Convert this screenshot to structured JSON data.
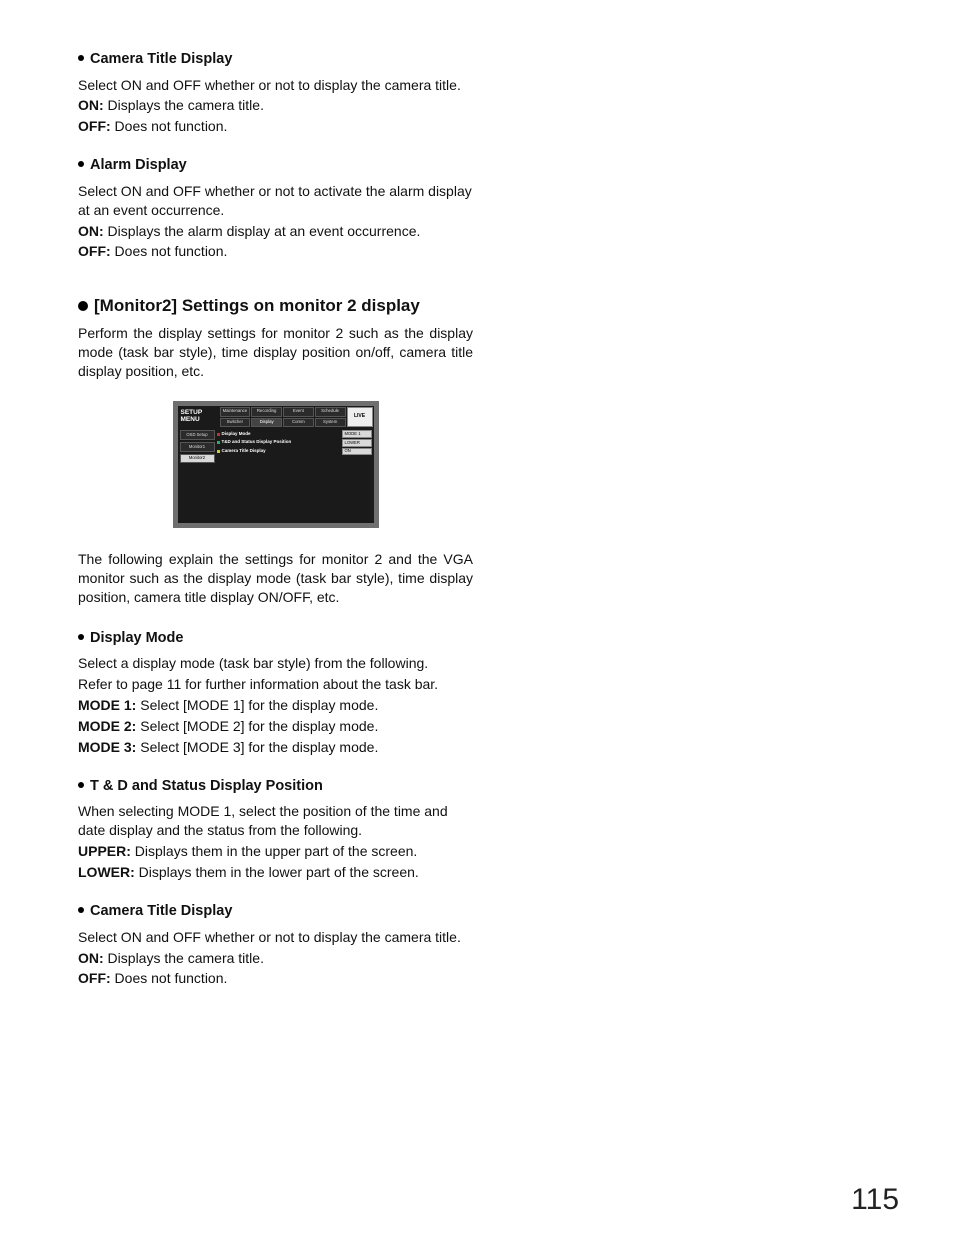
{
  "sections": {
    "camera_title_1": {
      "heading": "Camera Title Display",
      "intro": "Select ON and OFF whether or not to display the camera title.",
      "on_label": "ON:",
      "on_text": " Displays the camera title.",
      "off_label": "OFF:",
      "off_text": " Does not function."
    },
    "alarm": {
      "heading": "Alarm Display",
      "intro": "Select ON and OFF whether or not to activate the alarm display at an event occurrence.",
      "on_label": "ON:",
      "on_text": " Displays the alarm display at an event occurrence.",
      "off_label": "OFF:",
      "off_text": " Does not function."
    },
    "monitor2": {
      "heading": "[Monitor2] Settings on monitor 2 display",
      "intro": "Perform the display settings for monitor 2 such as the display mode (task bar style), time display position on/off, camera title display position, etc.",
      "after_figure": "The following explain the settings for monitor 2 and the VGA monitor such as the display mode (task bar style), time display position, camera title display ON/OFF, etc."
    },
    "display_mode": {
      "heading": "Display Mode",
      "l1": "Select a display mode (task bar style) from the following.",
      "l2": "Refer to page 11 for further information about the task bar.",
      "m1_label": "MODE 1:",
      "m1_text": " Select [MODE 1] for the display mode.",
      "m2_label": "MODE 2:",
      "m2_text": " Select [MODE 2] for the display mode.",
      "m3_label": "MODE 3:",
      "m3_text": " Select [MODE 3] for the display mode."
    },
    "td_status": {
      "heading": "T & D and Status Display Position",
      "intro": "When selecting MODE 1, select the position of the time and date display and the status from the following.",
      "upper_label": "UPPER:",
      "upper_text": " Displays them in the upper part of the screen.",
      "lower_label": "LOWER:",
      "lower_text": " Displays them in the lower part of the screen."
    },
    "camera_title_2": {
      "heading": "Camera Title Display",
      "intro": "Select ON and OFF whether or not to display the camera title.",
      "on_label": "ON:",
      "on_text": " Displays the camera title.",
      "off_label": "OFF:",
      "off_text": " Does not function."
    }
  },
  "figure": {
    "title": "SETUP MENU",
    "tabs_top": [
      "Maintenance",
      "Recording",
      "Event",
      "Schedule"
    ],
    "tabs_bottom": [
      "Switcher",
      "Display",
      "Comm",
      "System"
    ],
    "live": "LIVE",
    "side": [
      "OSD Setup",
      "Monitor1",
      "Monitor2"
    ],
    "rows": [
      {
        "label": "Display Mode",
        "value": "MODE 1"
      },
      {
        "label": "T&D and Status Display Position",
        "value": "LOWER"
      },
      {
        "label": "Camera Title Display",
        "value": "ON"
      }
    ]
  },
  "page_number": "115"
}
